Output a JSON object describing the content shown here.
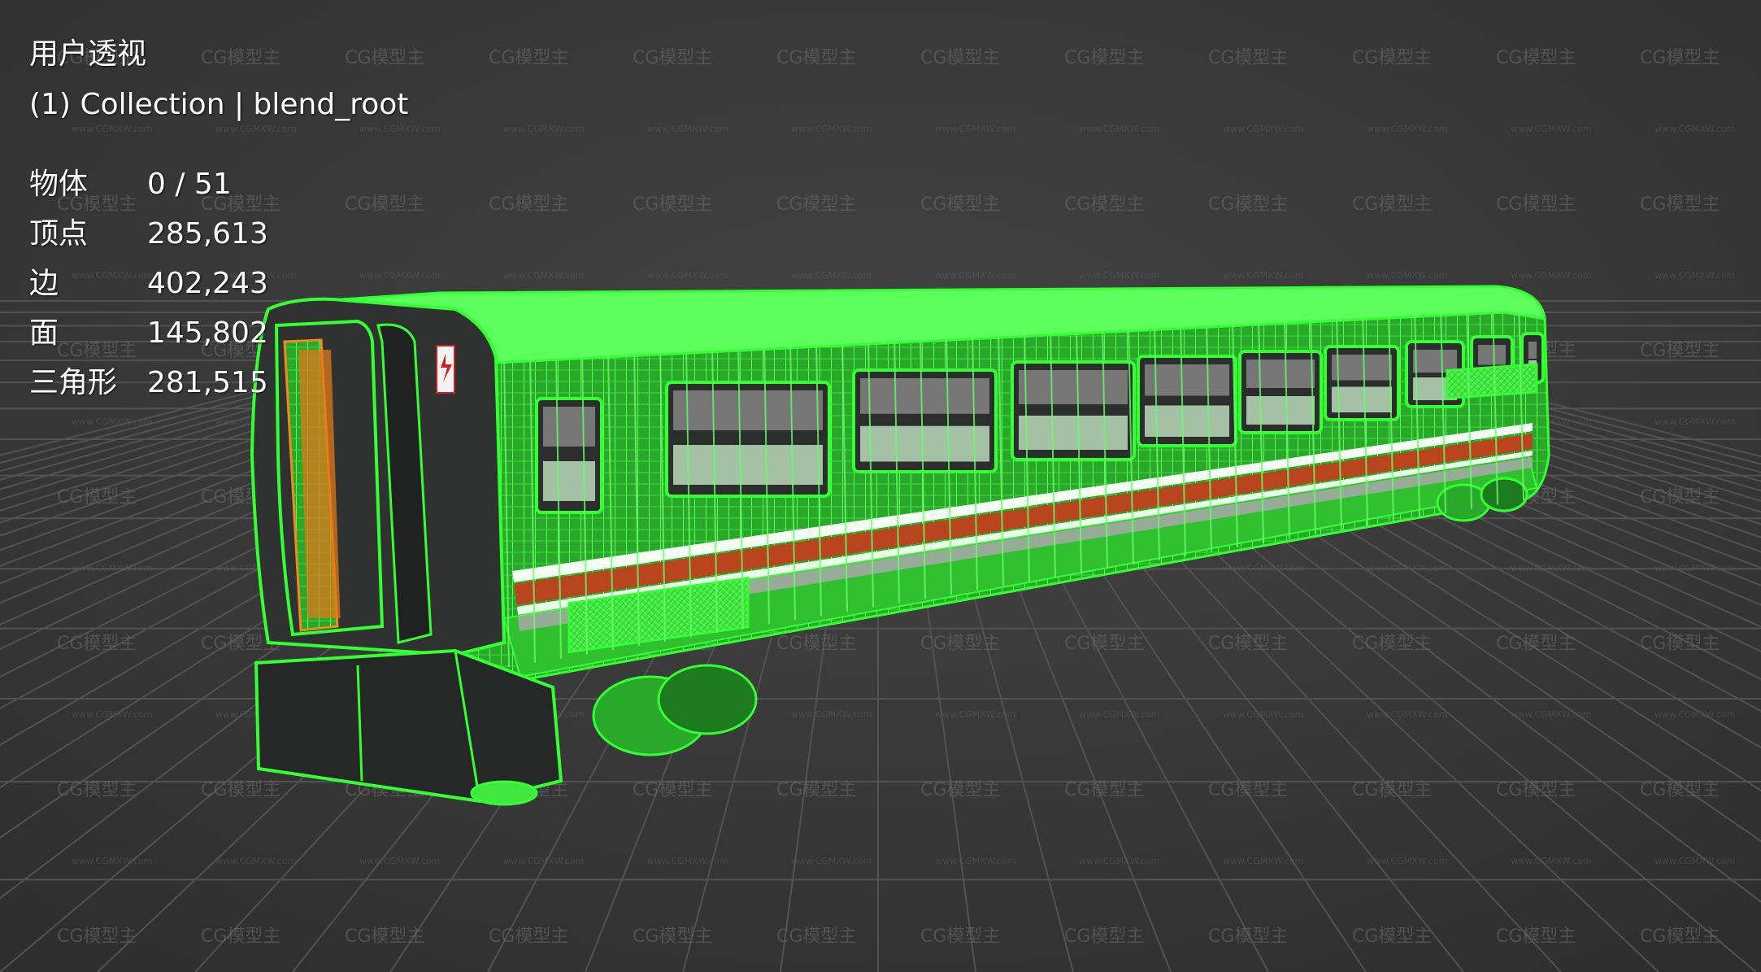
{
  "viewport": {
    "view_name": "用户透视",
    "collection_label": "(1) Collection | blend_root",
    "background_color": "#3d3d3d",
    "wireframe_color": "#33ff33"
  },
  "stats": [
    {
      "label": "物体",
      "value": "0 / 51"
    },
    {
      "label": "顶点",
      "value": "285,613"
    },
    {
      "label": "边",
      "value": "402,243"
    },
    {
      "label": "面",
      "value": "145,802"
    },
    {
      "label": "三角形",
      "value": "281,515"
    }
  ],
  "watermark": {
    "logo_text": "CG模型主",
    "url_text": "www.CGMXW.com"
  }
}
